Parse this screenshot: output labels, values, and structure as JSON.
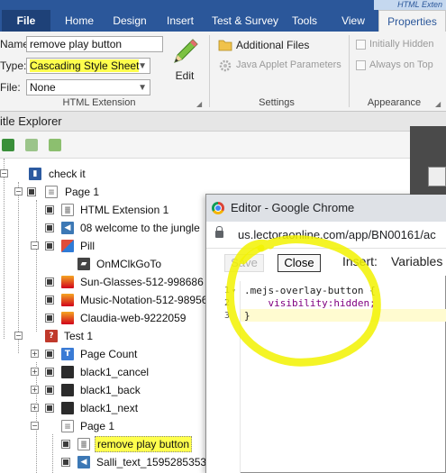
{
  "ribbon": {
    "context_title": "HTML Exten",
    "tabs": [
      "File",
      "Home",
      "Design",
      "Insert",
      "Test & Survey",
      "Tools",
      "View",
      "Properties"
    ],
    "name_label": "Name:",
    "name_value": "remove play button",
    "type_label": "Type:",
    "type_value": "Cascading Style Sheet",
    "file_label": "File:",
    "file_value": "None",
    "edit_label": "Edit",
    "group_html_extension": "HTML Extension",
    "additional_files": "Additional Files",
    "java_applet": "Java Applet Parameters",
    "group_settings": "Settings",
    "initially_hidden": "Initially Hidden",
    "always_on_top": "Always on Top",
    "group_appearance": "Appearance"
  },
  "explorer": {
    "title": "itle Explorer",
    "items": [
      {
        "label": "check it"
      },
      {
        "label": "Page 1"
      },
      {
        "label": "HTML Extension 1"
      },
      {
        "label": "08 welcome to the jungle"
      },
      {
        "label": "Pill"
      },
      {
        "label": "OnMClkGoTo"
      },
      {
        "label": "Sun-Glasses-512-998686"
      },
      {
        "label": "Music-Notation-512-98956"
      },
      {
        "label": "Claudia-web-9222059"
      },
      {
        "label": "Test 1"
      },
      {
        "label": "Page Count"
      },
      {
        "label": "black1_cancel"
      },
      {
        "label": "black1_back"
      },
      {
        "label": "black1_next"
      },
      {
        "label": "Page 1"
      },
      {
        "label": "remove play button"
      },
      {
        "label": "Salli_text_1595285353"
      }
    ]
  },
  "editor": {
    "window_title": "Editor - Google Chrome",
    "url": "us.lectoraonline.com/app/BN00161/ac",
    "save_label": "Save",
    "close_label": "Close",
    "insert_label": "Insert:",
    "variables_label": "Variables",
    "code_lines": [
      {
        "num": "1",
        "text": ".mejs-overlay-button {"
      },
      {
        "num": "2",
        "text": "    visibility:hidden;"
      },
      {
        "num": "3",
        "text": "}"
      }
    ]
  },
  "colors": {
    "ribbon_blue": "#2b579a",
    "highlight_yellow": "#ffff4d",
    "annotation_yellow": "#f2f200"
  }
}
